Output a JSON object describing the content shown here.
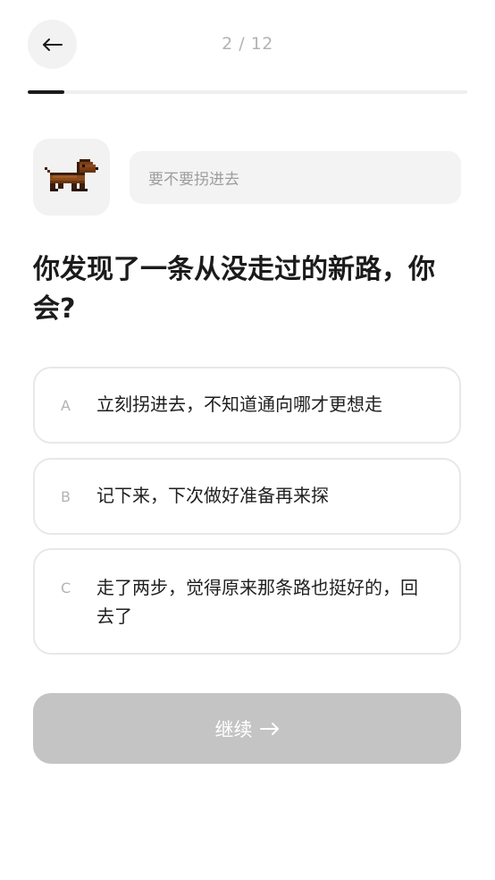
{
  "header": {
    "back_icon": "arrow-left-icon",
    "progress_text": "2 / 12",
    "progress": {
      "current": 2,
      "total": 12,
      "fraction": 0.083
    }
  },
  "prompt": {
    "avatar_icon": "pixel-dachshund-icon",
    "speech_text": "要不要拐进去"
  },
  "question": {
    "text": "你发现了一条从没走过的新路，你会?"
  },
  "options": [
    {
      "key": "A",
      "text": "立刻拐进去，不知道通向哪才更想走"
    },
    {
      "key": "B",
      "text": "记下来，下次做好准备再来探"
    },
    {
      "key": "C",
      "text": "走了两步，觉得原来那条路也挺好的，回去了"
    }
  ],
  "footer": {
    "continue_label": "继续",
    "continue_icon": "arrow-right-icon",
    "enabled": false
  },
  "colors": {
    "accent": "#1b1b1b",
    "muted": "#b3b3b3",
    "disabled_button": "#c4c4c4",
    "option_border": "#e8e8e8",
    "chip_bg": "#f2f2f2"
  }
}
